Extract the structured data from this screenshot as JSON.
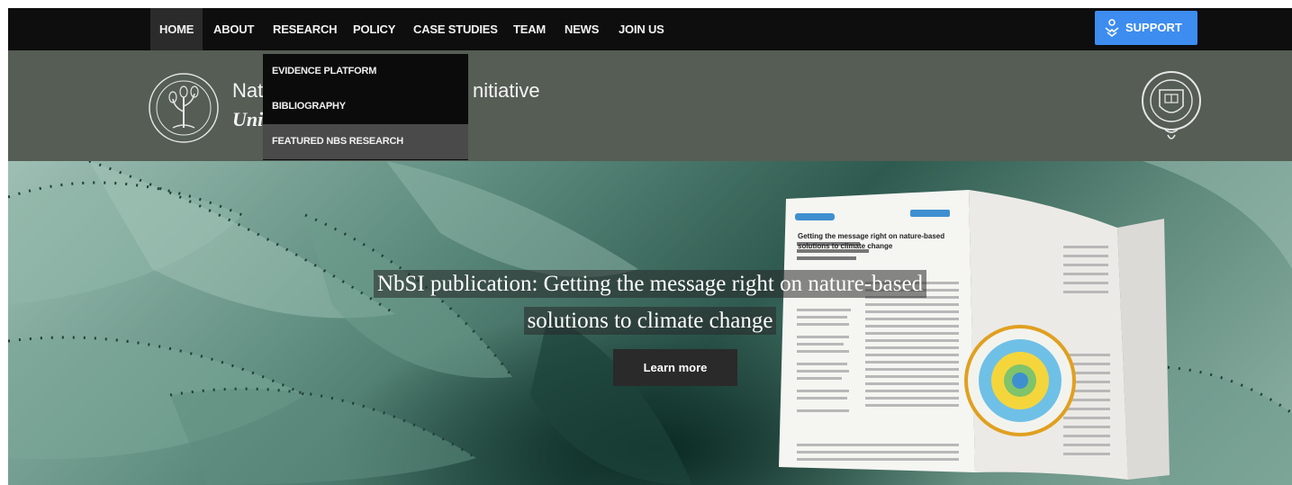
{
  "nav": {
    "items": [
      "HOME",
      "ABOUT",
      "RESEARCH",
      "POLICY",
      "CASE STUDIES",
      "TEAM",
      "NEWS",
      "JOIN US"
    ],
    "support_label": "SUPPORT"
  },
  "dropdown": {
    "items": [
      "EVIDENCE PLATFORM",
      "BIBLIOGRAPHY",
      "FEATURED NBS RESEARCH"
    ]
  },
  "header": {
    "site_name_line1_visible_left": "Nat",
    "site_name_line1_visible_right": "nitiative",
    "site_name_line2_visible": "Uni"
  },
  "hero": {
    "title_line1": "NbSI publication: Getting the message right on nature-based",
    "title_line2": "solutions to climate change",
    "cta_label": "Learn more",
    "journal_article_title": "Getting the message right on nature-based solutions to climate change"
  },
  "colors": {
    "nav_bg": "#0e0e0e",
    "header_bg": "#555d55",
    "support_bg": "#3d8cf0",
    "dropdown_bg": "#0b0b0b"
  }
}
